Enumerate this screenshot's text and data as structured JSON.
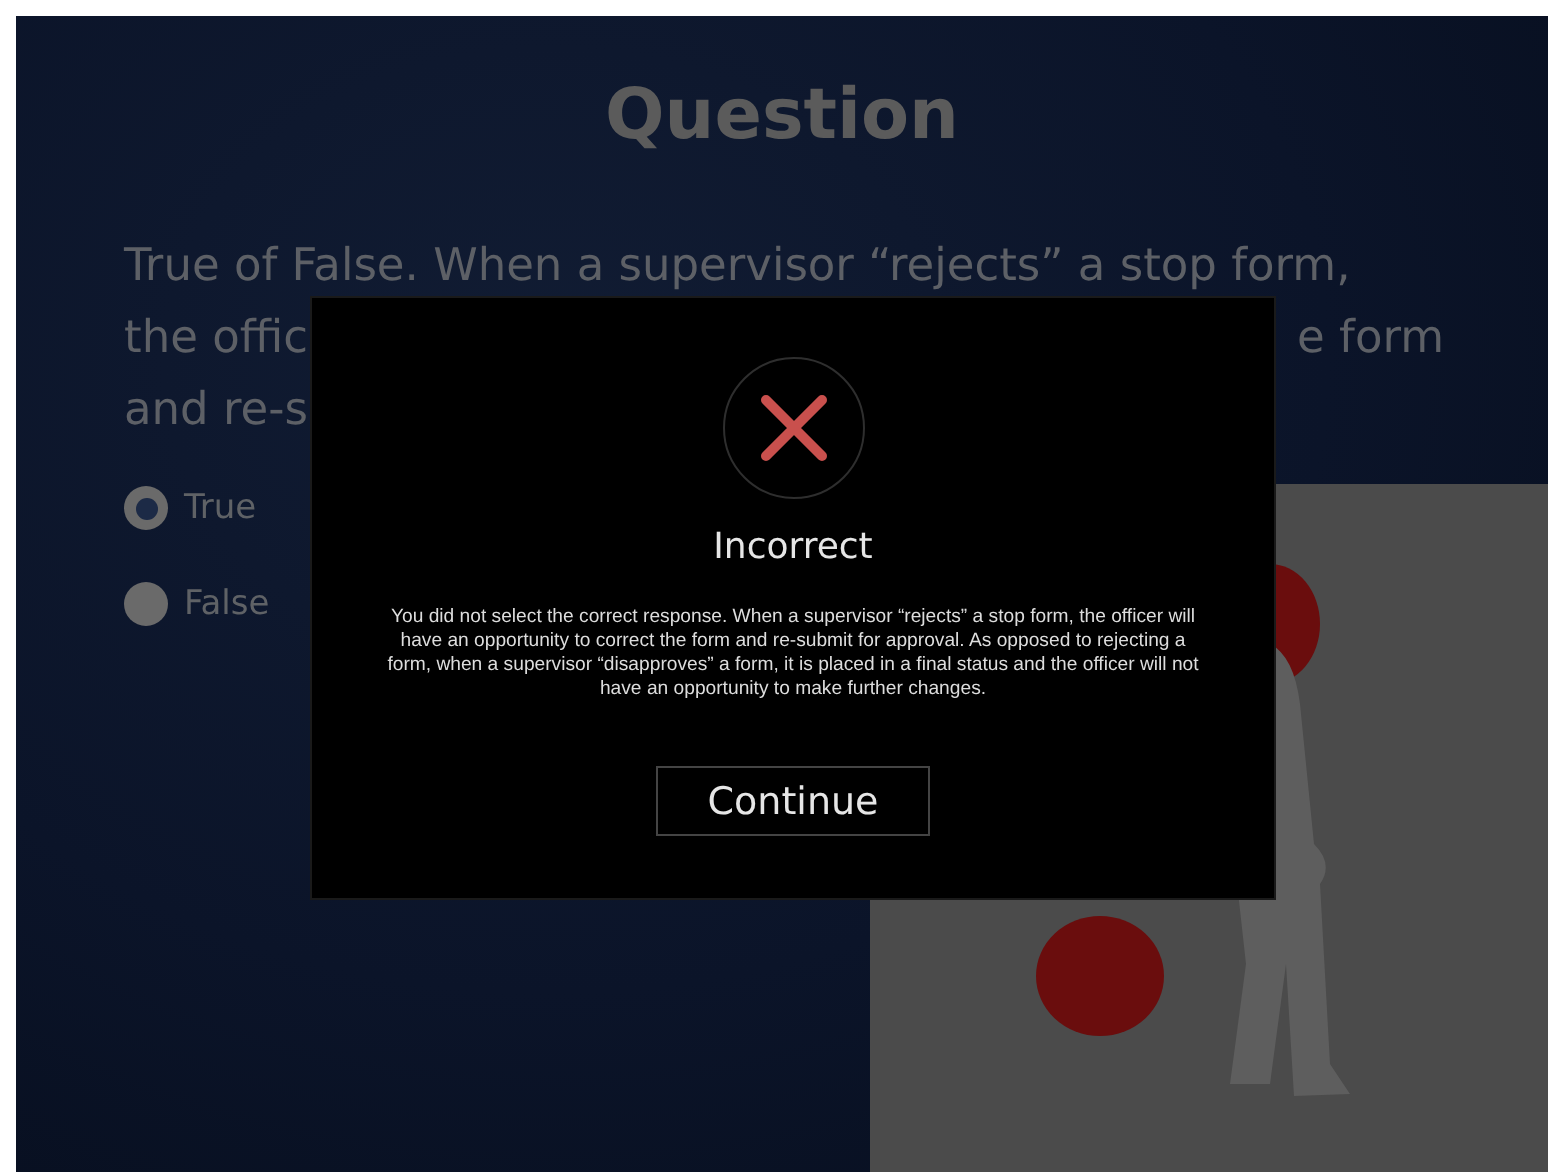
{
  "slide": {
    "title": "Question",
    "question_lines": [
      {
        "left": "True of False. When a supervisor “rejects” a stop form,"
      },
      {
        "left": "the offic",
        "right": "e form"
      },
      {
        "left": "and re-s"
      }
    ],
    "options": [
      {
        "label": "True",
        "selected": true
      },
      {
        "label": "False",
        "selected": false
      }
    ]
  },
  "dialog": {
    "kind": "incorrect",
    "title": "Incorrect",
    "message": "You did not select the correct response. When a supervisor “rejects” a stop form, the officer will have an opportunity to correct the form and re-submit for approval. As opposed to rejecting a form, when a supervisor “disapproves” a form, it is placed in a final status and the officer will not have an opportunity to make further changes.",
    "button": "Continue"
  }
}
